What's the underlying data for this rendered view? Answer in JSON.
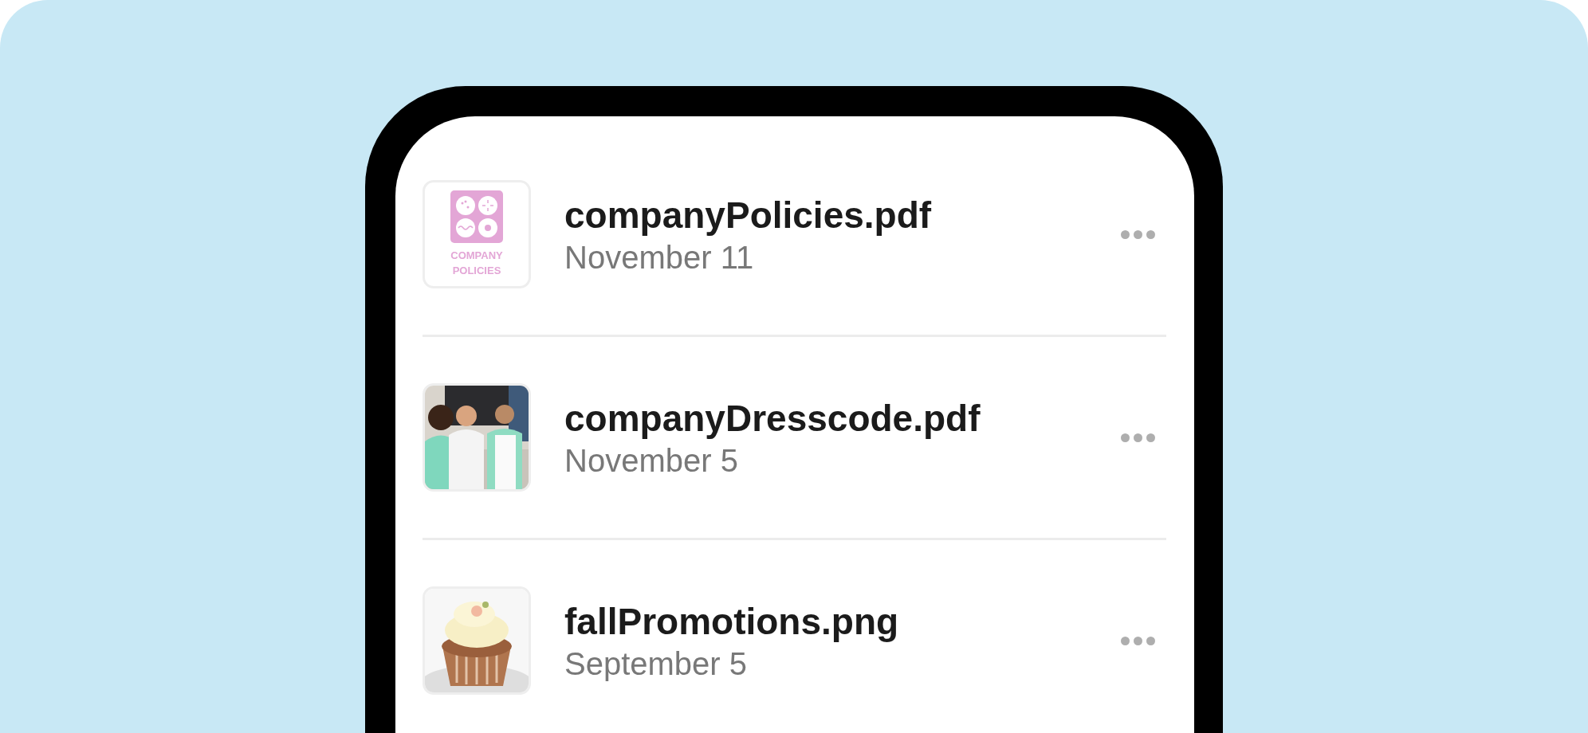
{
  "files": [
    {
      "name": "companyPolicies.pdf",
      "date": "November 11",
      "thumbnail": {
        "kind": "badge",
        "lines": [
          "COMPANY",
          "POLICIES"
        ]
      }
    },
    {
      "name": "companyDresscode.pdf",
      "date": "November 5"
    },
    {
      "name": "fallPromotions.png",
      "date": "September 5"
    }
  ]
}
